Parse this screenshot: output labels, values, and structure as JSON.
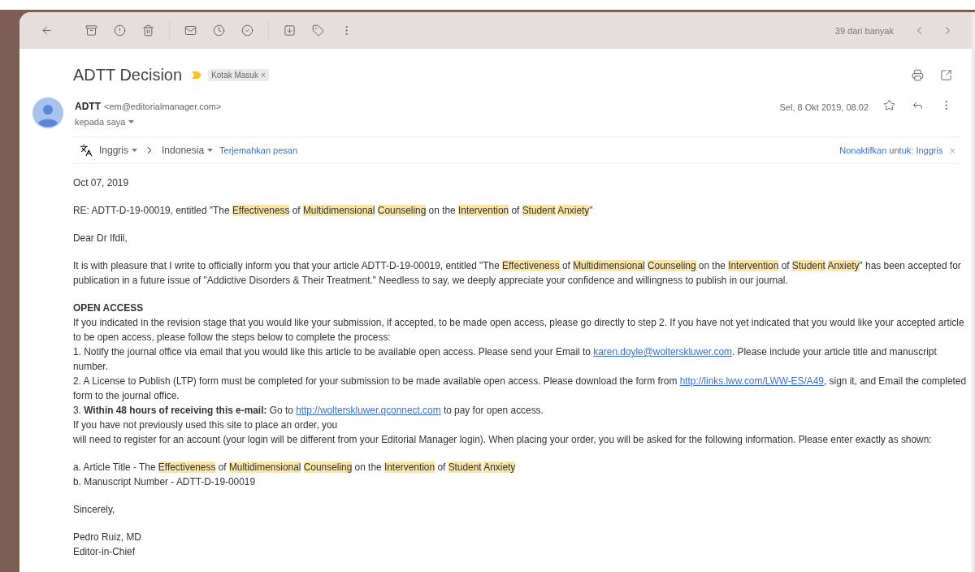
{
  "toolbar": {
    "counter": "39 dari banyak"
  },
  "subject": {
    "title": "ADTT Decision",
    "important": true,
    "label": {
      "text": "Kotak Masuk",
      "remove": "×"
    }
  },
  "sender": {
    "name": "ADTT",
    "email": "<em@editorialmanager.com>",
    "recipient": "kepada saya",
    "date": "Sel, 8 Okt 2019, 08.02",
    "starred": false
  },
  "translate": {
    "source": "Inggris",
    "target": "Indonesia",
    "action": "Terjemahkan pesan",
    "disable": "Nonaktifkan untuk: Inggris",
    "close": "×"
  },
  "body": [
    {
      "lines": [
        [
          {
            "kind": "plain",
            "text": "Oct 07, 2019"
          }
        ]
      ]
    },
    {
      "lines": [
        [
          {
            "kind": "plain",
            "text": "RE: ADTT-D-19-00019, entitled \"The "
          },
          {
            "kind": "mark",
            "text": "Effectiveness"
          },
          {
            "kind": "plain",
            "text": " of "
          },
          {
            "kind": "mark",
            "text": "Multidimensional Counseling"
          },
          {
            "kind": "plain",
            "text": " on the "
          },
          {
            "kind": "mark",
            "text": "Intervention"
          },
          {
            "kind": "plain",
            "text": " of "
          },
          {
            "kind": "mark",
            "text": "Student Anxiety"
          },
          {
            "kind": "plain",
            "text": "\""
          }
        ]
      ]
    },
    {
      "lines": [
        [
          {
            "kind": "plain",
            "text": "Dear Dr Ifdil,"
          }
        ]
      ]
    },
    {
      "lines": [
        [
          {
            "kind": "plain",
            "text": "It is with pleasure that I write to officially inform you that your article ADTT-D-19-00019, entitled \"The "
          },
          {
            "kind": "mark",
            "text": "Effectiveness"
          },
          {
            "kind": "plain",
            "text": " of "
          },
          {
            "kind": "mark",
            "text": "Multidimensional Counseling"
          },
          {
            "kind": "plain",
            "text": " on the "
          },
          {
            "kind": "mark",
            "text": "Intervention"
          },
          {
            "kind": "plain",
            "text": " of "
          },
          {
            "kind": "mark",
            "text": "Student Anxiety"
          },
          {
            "kind": "plain",
            "text": "\" has been accepted for publication in a future issue of \"Addictive Disorders & Their Treatment.\" Needless to say, we deeply appreciate your confidence and willingness to publish in our journal."
          }
        ]
      ]
    },
    {
      "lines": [
        [
          {
            "kind": "bold",
            "text": "OPEN ACCESS"
          }
        ],
        [
          {
            "kind": "plain",
            "text": "If you indicated in the revision stage that you would like your submission, if accepted, to be made open access, please go directly to step 2. If you have not yet indicated that you would like your accepted article to be open access, please follow the steps below to complete the process:"
          }
        ],
        [
          {
            "kind": "plain",
            "text": "1. Notify the journal office via email that you would like this article to be available open access. Please send your Email to "
          },
          {
            "kind": "link",
            "text": "karen.doyle@wolterskluwer.com"
          },
          {
            "kind": "plain",
            "text": ". Please include your article title and manuscript number."
          }
        ],
        [
          {
            "kind": "plain",
            "text": "2. A License to Publish (LTP) form must be completed for your submission to be made available open access. Please download the form from "
          },
          {
            "kind": "link",
            "text": "http://links.lww.com/LWW-ES/A49"
          },
          {
            "kind": "plain",
            "text": ", sign it, and Email the completed form to the journal office."
          }
        ],
        [
          {
            "kind": "plain",
            "text": "3. "
          },
          {
            "kind": "bold",
            "text": "Within 48 hours of receiving this e-mail:"
          },
          {
            "kind": "plain",
            "text": " Go to "
          },
          {
            "kind": "link",
            "text": "http://wolterskluwer.qconnect.com"
          },
          {
            "kind": "plain",
            "text": " to pay for open access."
          }
        ],
        [
          {
            "kind": "plain",
            "text": "If you have not previously used this site to place an order, you"
          }
        ],
        [
          {
            "kind": "plain",
            "text": "will need to register for an account (your login will be different from your Editorial Manager login). When placing your order, you will be asked for the following information. Please enter exactly as shown:"
          }
        ]
      ]
    },
    {
      "lines": [
        [
          {
            "kind": "plain",
            "text": "a. Article Title - The "
          },
          {
            "kind": "mark",
            "text": "Effectiveness"
          },
          {
            "kind": "plain",
            "text": " of "
          },
          {
            "kind": "mark",
            "text": "Multidimensional Counseling"
          },
          {
            "kind": "plain",
            "text": " on the "
          },
          {
            "kind": "mark",
            "text": "Intervention"
          },
          {
            "kind": "plain",
            "text": " of "
          },
          {
            "kind": "mark",
            "text": "Student Anxiety"
          }
        ],
        [
          {
            "kind": "plain",
            "text": "b. Manuscript Number - ADTT-D-19-00019"
          }
        ]
      ]
    },
    {
      "lines": [
        [
          {
            "kind": "plain",
            "text": "Sincerely,"
          }
        ]
      ]
    },
    {
      "lines": [
        [
          {
            "kind": "plain",
            "text": "Pedro Ruiz, MD"
          }
        ],
        [
          {
            "kind": "plain",
            "text": "Editor-in-Chief"
          }
        ]
      ]
    }
  ]
}
